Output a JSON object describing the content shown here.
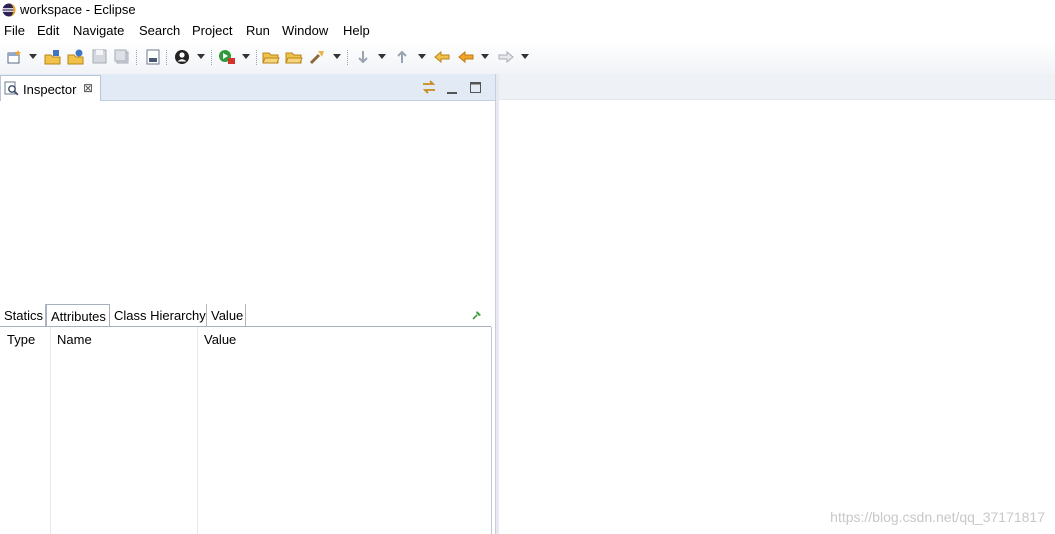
{
  "window": {
    "title": "workspace - Eclipse"
  },
  "menu": {
    "items": [
      {
        "label": "File"
      },
      {
        "label": "Edit"
      },
      {
        "label": "Navigate"
      },
      {
        "label": "Search"
      },
      {
        "label": "Project"
      },
      {
        "label": "Run"
      },
      {
        "label": "Window"
      },
      {
        "label": "Help"
      }
    ]
  },
  "toolbar": {
    "icons": [
      "new-icon",
      "open-project-icon",
      "open-type-icon",
      "save-icon",
      "save-all-icon",
      "binary-icon",
      "user-icon",
      "run-icon",
      "open-folder-icon",
      "open-file-icon",
      "tools-icon",
      "next-annotation-icon",
      "prev-annotation-icon",
      "last-edit-icon",
      "back-icon",
      "forward-icon"
    ]
  },
  "inspector": {
    "tab_label": "Inspector",
    "close_symbol": "⊠",
    "inner_tabs": [
      {
        "label": "Statics"
      },
      {
        "label": "Attributes"
      },
      {
        "label": "Class Hierarchy"
      },
      {
        "label": "Value"
      }
    ],
    "active_tab": "Attributes",
    "table": {
      "columns": [
        {
          "label": "Type"
        },
        {
          "label": "Name"
        },
        {
          "label": "Value"
        }
      ],
      "rows": []
    }
  },
  "watermark": "https://blog.csdn.net/qq_37171817",
  "colors": {
    "toolbar_bg": "#f1f3f7",
    "view_header_bg": "#e2eaf5",
    "accent_orange": "#f0a52a",
    "accent_green": "#2e9b3a",
    "accent_red": "#d0342c"
  }
}
